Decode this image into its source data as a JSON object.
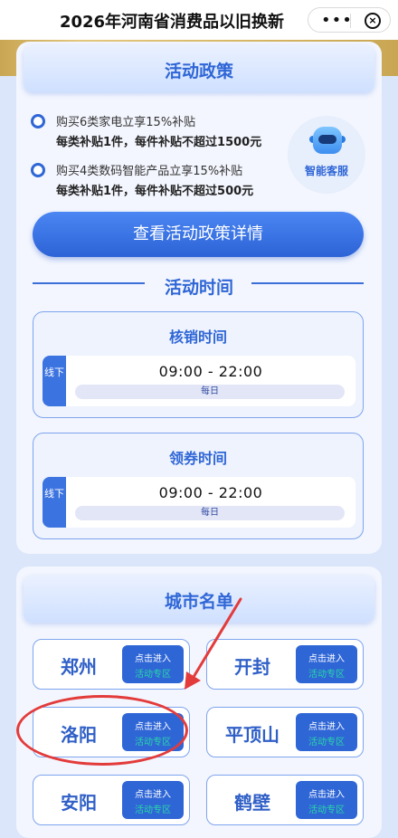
{
  "topbar": {
    "title": "2026年河南省消费品以旧换新"
  },
  "policy": {
    "header": "活动政策",
    "items": [
      {
        "line1": "购买6类家电立享15%补贴",
        "line2": "每类补贴1件，每件补贴不超过1500元"
      },
      {
        "line1": "购买4类数码智能产品立享15%补贴",
        "line2": "每类补贴1件，每件补贴不超过500元"
      }
    ],
    "assistant_label": "智能客服",
    "detail_button": "查看活动政策详情"
  },
  "schedule": {
    "title": "活动时间",
    "cards": [
      {
        "title": "核销时间",
        "tag": "线下",
        "time": "09:00 - 22:00",
        "daily": "每日"
      },
      {
        "title": "领券时间",
        "tag": "线下",
        "time": "09:00 - 22:00",
        "daily": "每日"
      }
    ]
  },
  "cities": {
    "header": "城市名单",
    "enter_line1": "点击进入",
    "enter_line2": "活动专区",
    "list": [
      "郑州",
      "开封",
      "洛阳",
      "平顶山",
      "安阳",
      "鹤壁"
    ]
  },
  "colors": {
    "accent": "#2f66d6",
    "annotation": "#e33b3b",
    "banner_gold": "#d7b866"
  }
}
